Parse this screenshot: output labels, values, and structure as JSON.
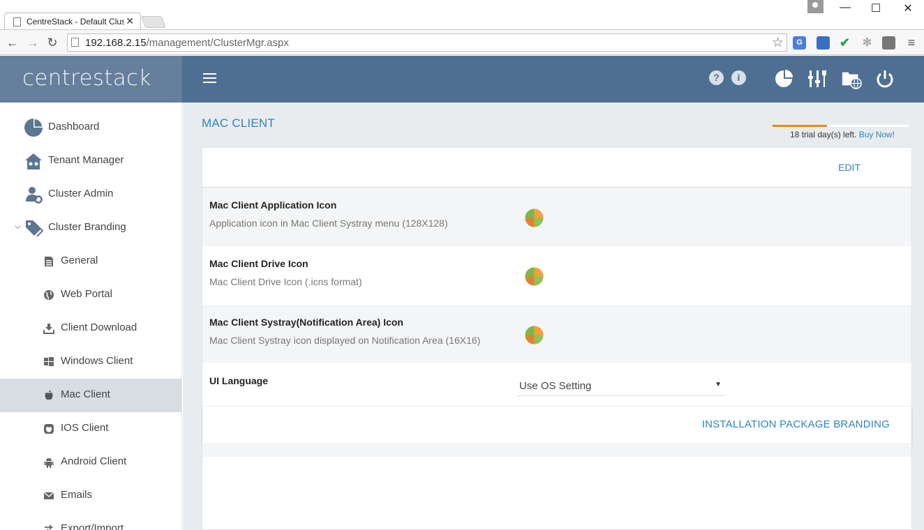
{
  "browser": {
    "tab_title": "CentreStack - Default Clus",
    "url_host": "192.168.2.15",
    "url_path": "/management/ClusterMgr.aspx"
  },
  "header": {
    "brand": "centrestack",
    "help_label": "?",
    "info_label": "i"
  },
  "sidebar": {
    "items": [
      {
        "label": "Dashboard"
      },
      {
        "label": "Tenant Manager"
      },
      {
        "label": "Cluster Admin"
      },
      {
        "label": "Cluster Branding"
      },
      {
        "label": "General"
      },
      {
        "label": "Web Portal"
      },
      {
        "label": "Client Download"
      },
      {
        "label": "Windows Client"
      },
      {
        "label": "Mac Client"
      },
      {
        "label": "IOS Client"
      },
      {
        "label": "Android Client"
      },
      {
        "label": "Emails"
      },
      {
        "label": "Export/Import"
      }
    ]
  },
  "main": {
    "title": "MAC CLIENT",
    "trial": {
      "text": "18 trial day(s) left. ",
      "buy_label": "Buy Now!",
      "progress": 0.4
    },
    "edit_label": "EDIT",
    "rows": [
      {
        "title": "Mac Client Application Icon",
        "desc": "Application icon in Mac Client Systray menu (128X128)"
      },
      {
        "title": "Mac Client Drive Icon",
        "desc": "Mac Client Drive Icon (.icns format)"
      },
      {
        "title": "Mac Client Systray(Notification Area) Icon",
        "desc": "Mac Client Systray icon displayed on Notification Area (16X16)"
      }
    ],
    "language": {
      "label": "UI Language",
      "value": "Use OS Setting"
    },
    "install_label": "INSTALLATION PACKAGE BRANDING"
  },
  "colors": {
    "header_bg": "#4e6f92",
    "brand_bg": "#657f9c",
    "accent": "#2c84c6",
    "trial_orange": "#e98a1b"
  }
}
